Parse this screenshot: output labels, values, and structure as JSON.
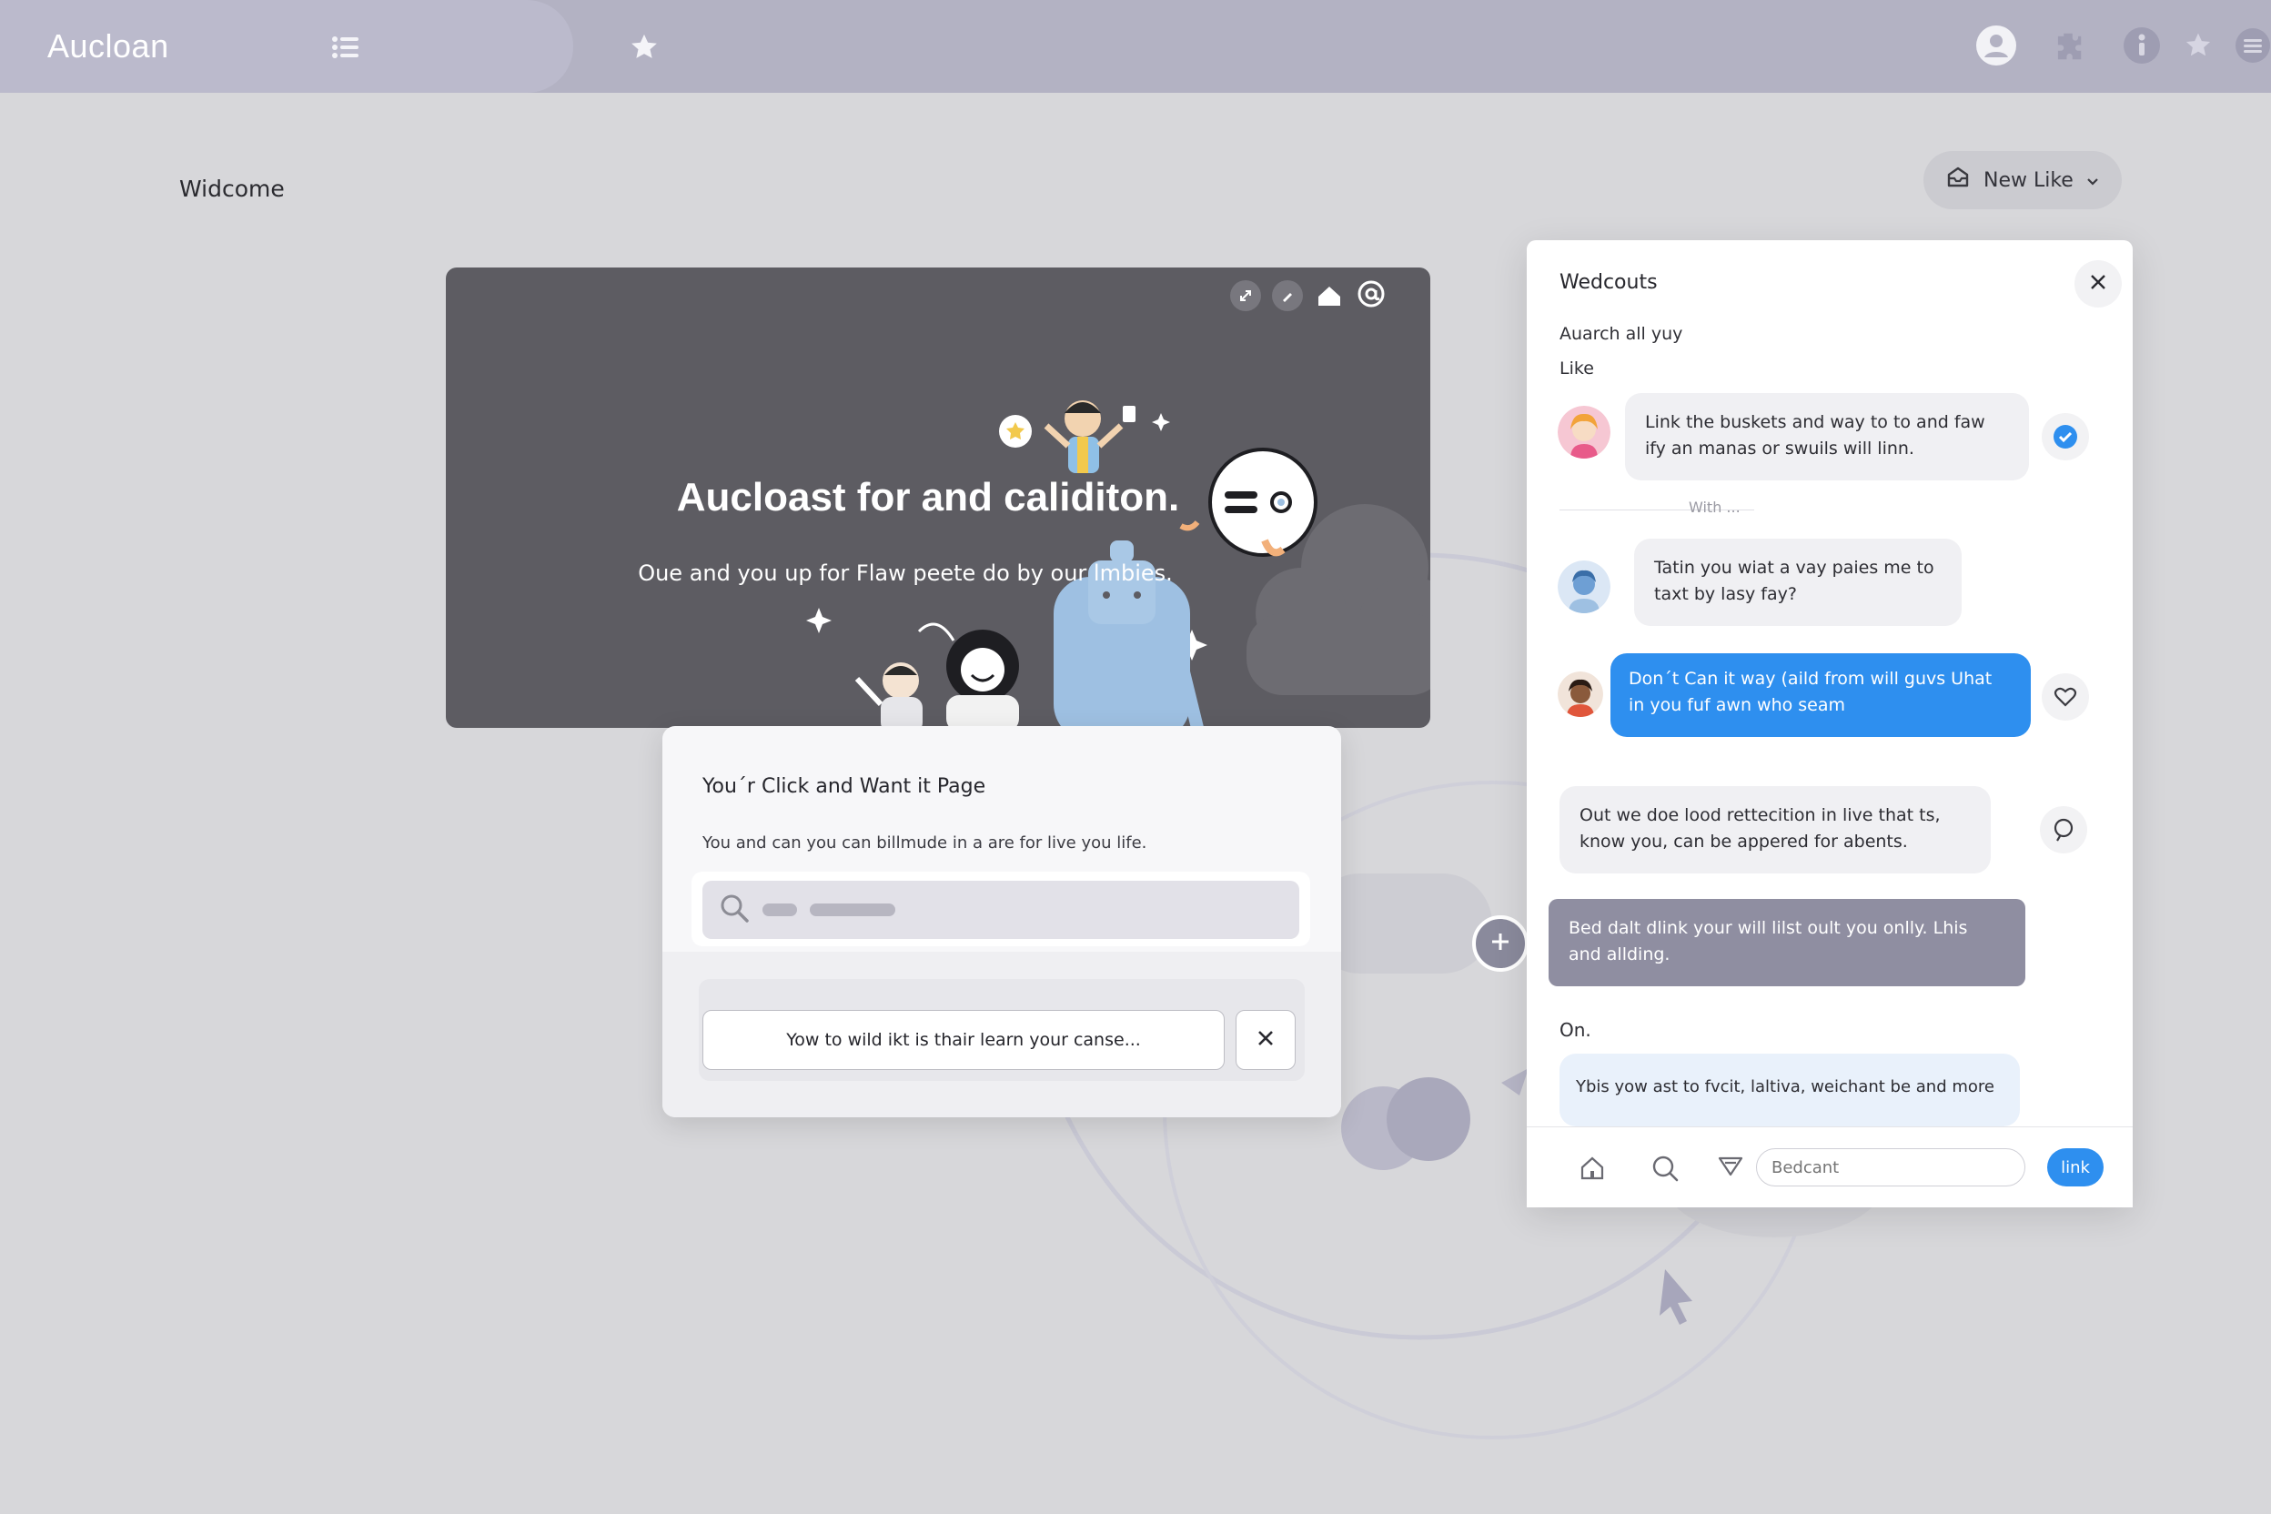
{
  "app": {
    "brand": "Aucloan"
  },
  "topbar": {
    "icons": [
      "list-icon",
      "star-icon",
      "account-icon",
      "puzzle-icon",
      "info-icon",
      "star-icon",
      "menu-icon"
    ]
  },
  "page": {
    "welcome": "Widcome",
    "new_like_label": "New Like"
  },
  "hero": {
    "title": "Aucloast for and caliditon.",
    "subtitle": "Oue and you up for Flaw peete do by our lmbies.",
    "controls": [
      "expand-icon",
      "edit-icon",
      "home-icon",
      "at-icon"
    ]
  },
  "dialog": {
    "title": "You´r Click and Want it Page",
    "text": "You and can you can billmude in a are for live you life.",
    "button_label": "Yow to wild ikt is thair learn your canse..."
  },
  "chat": {
    "title": "Wedcouts",
    "subtitle1": "Auarch all yuy",
    "subtitle2": "Like",
    "divider_label": "With ...",
    "messages": [
      {
        "text": "Link the buskets and way to to and faw ify an manas or swuils will linn."
      },
      {
        "text": "Tatin you wiat a vay paies me to taxt by lasy fay?"
      },
      {
        "text": "Don´t Can it way (aild from will guvs Uhat in you fuf awn who seam"
      },
      {
        "text": "Out we doe lood rettecition in live that ts, know you, can be appered for abents."
      },
      {
        "text": "Bed dalt dlink your will lilst oult you onlly. Lhis and allding."
      }
    ],
    "section_label": "On.",
    "last_message": "Ybis yow ast to fvcit, laltiva, weichant be and more",
    "input_placeholder": "Bedcant",
    "send_label": "link"
  },
  "colors": {
    "accent": "#2e8fef",
    "topbar": "#b3b2c3",
    "hero_bg": "#5d5c62",
    "gray_bubble": "#8f8ea1"
  }
}
